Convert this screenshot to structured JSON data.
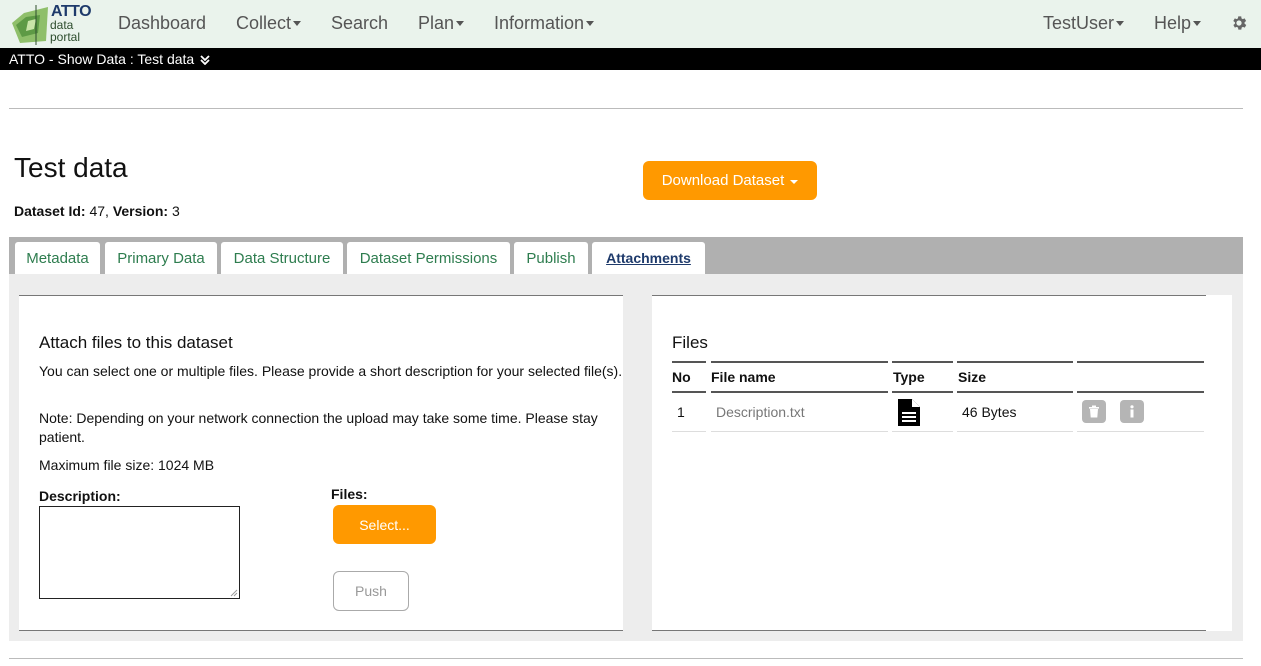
{
  "brand": {
    "line1": "ATTO",
    "line2": "data",
    "line3": "portal"
  },
  "nav": {
    "items": [
      {
        "label": "Dashboard",
        "dropdown": false
      },
      {
        "label": "Collect",
        "dropdown": true
      },
      {
        "label": "Search",
        "dropdown": false
      },
      {
        "label": "Plan",
        "dropdown": true
      },
      {
        "label": "Information",
        "dropdown": true
      }
    ],
    "user": "TestUser",
    "help": "Help",
    "settings_icon": "gear-icon"
  },
  "breadcrumb": {
    "text": "ATTO - Show Data : Test data",
    "icon": "double-chevron-down-icon"
  },
  "dataset": {
    "title": "Test data",
    "id_label": "Dataset Id:",
    "id_value": "47",
    "version_label": "Version:",
    "version_value": "3",
    "download_label": "Download Dataset"
  },
  "tabs": [
    {
      "label": "Metadata",
      "active": false
    },
    {
      "label": "Primary Data",
      "active": false
    },
    {
      "label": "Data Structure",
      "active": false
    },
    {
      "label": "Dataset Permissions",
      "active": false
    },
    {
      "label": "Publish",
      "active": false
    },
    {
      "label": "Attachments",
      "active": true
    }
  ],
  "attach": {
    "heading": "Attach files to this dataset",
    "info1": "You can select one or multiple files. Please provide a short description for your selected file(s).",
    "info2": "Note: Depending on your network connection the upload may take some time. Please stay patient.",
    "max_size": "Maximum file size: 1024 MB",
    "description_label": "Description:",
    "description_value": "",
    "files_label": "Files:",
    "select_label": "Select...",
    "push_label": "Push"
  },
  "files": {
    "heading": "Files",
    "columns": [
      "No",
      "File name",
      "Type",
      "Size",
      ""
    ],
    "rows": [
      {
        "no": "1",
        "name": "Description.txt",
        "type_icon": "document-icon",
        "size": "46 Bytes",
        "actions": [
          "trash-icon",
          "info-icon"
        ]
      }
    ]
  },
  "colors": {
    "accent": "#ff9900",
    "tab_text": "#2e7d4f",
    "nav_bg": "#eaf3ec"
  }
}
